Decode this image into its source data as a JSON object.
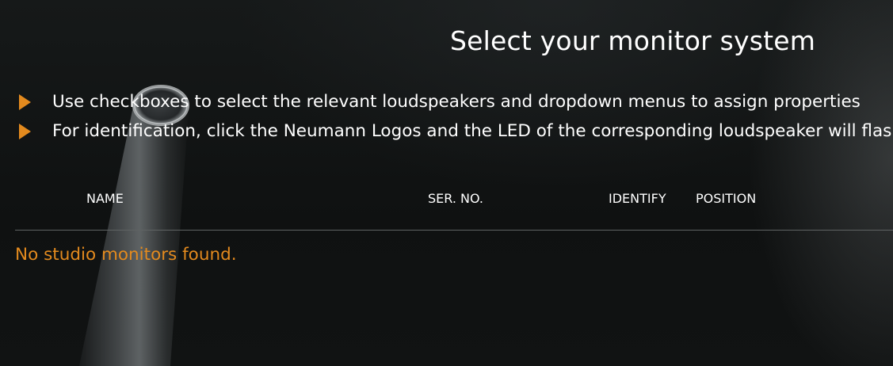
{
  "page": {
    "title": "Select your monitor system"
  },
  "instructions": [
    {
      "icon": "triangle-right-icon",
      "text": "Use checkboxes to select the relevant loudspeakers and dropdown menus to assign properties"
    },
    {
      "icon": "triangle-right-icon",
      "text": "For identification, click the Neumann Logos and the LED of the corresponding loudspeaker will flash"
    }
  ],
  "table": {
    "columns": [
      "NAME",
      "SER. NO.",
      "IDENTIFY",
      "POSITION"
    ],
    "rows": [],
    "empty_message": "No studio monitors found."
  },
  "colors": {
    "accent": "#e38a1e",
    "background": "#121414",
    "text": "#ffffff",
    "divider": "#5f6363"
  }
}
